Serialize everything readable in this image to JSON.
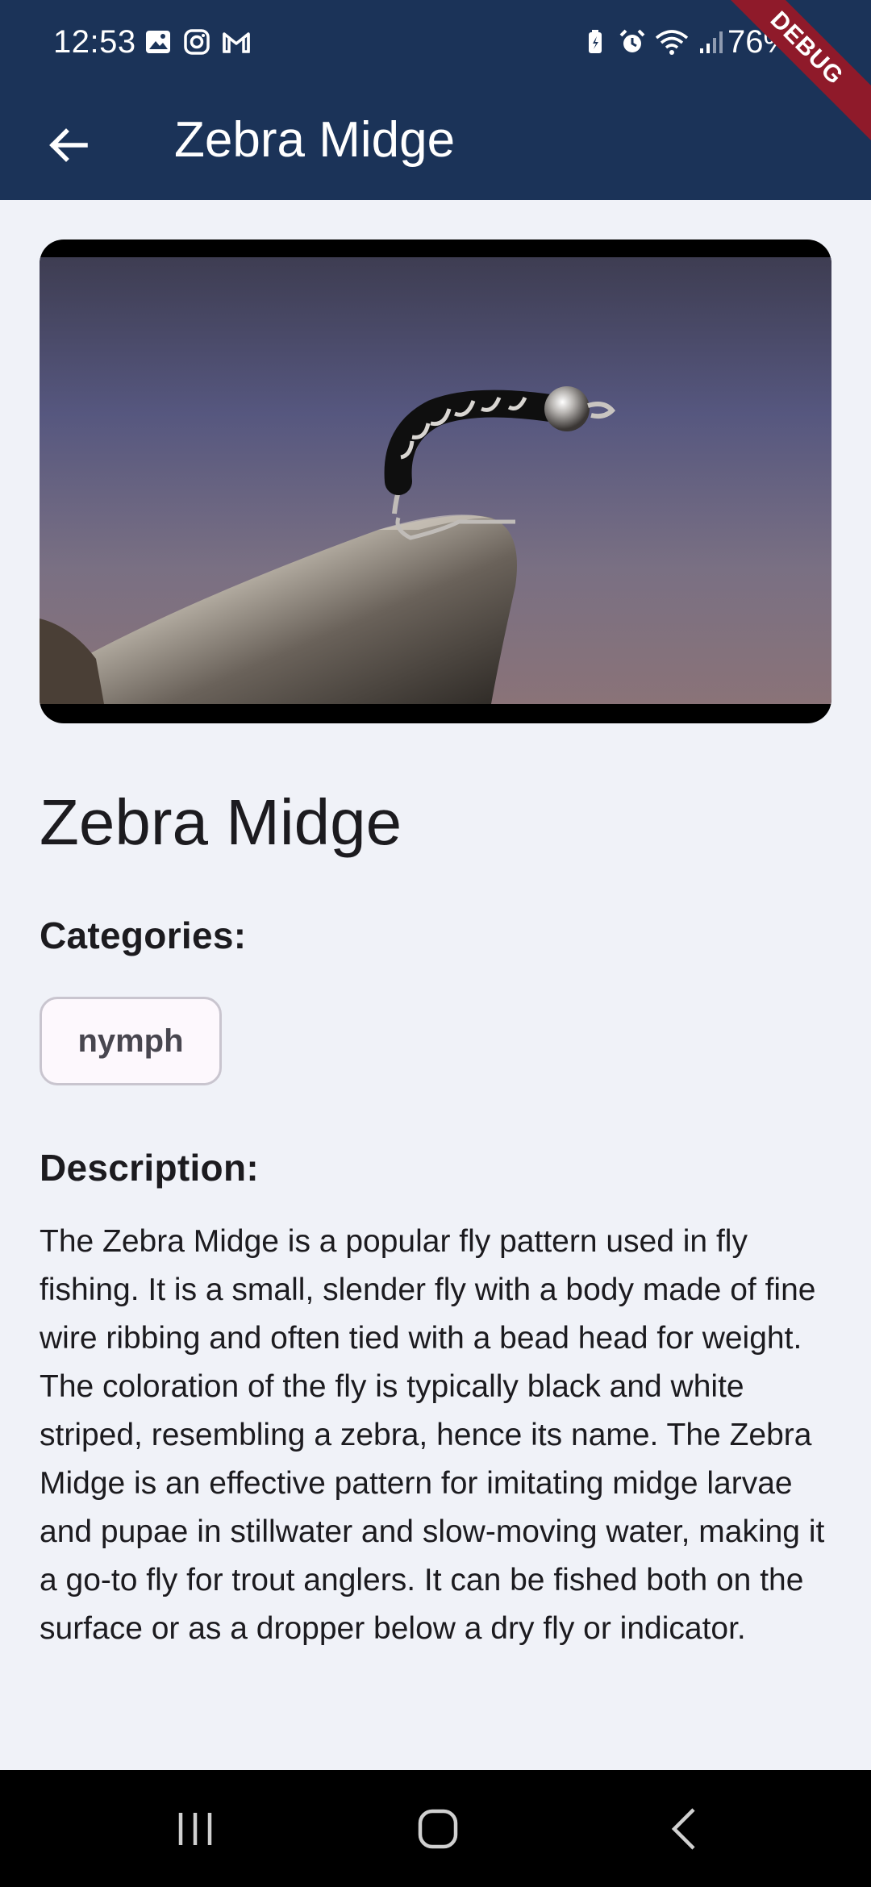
{
  "status_bar": {
    "time": "12:53",
    "battery": "76%",
    "left_icons": [
      "gallery-icon",
      "instagram-icon",
      "gmail-icon"
    ],
    "right_icons": [
      "battery-saver-icon",
      "alarm-icon",
      "wifi-icon",
      "signal-icon"
    ]
  },
  "app_bar": {
    "title": "Zebra Midge",
    "back_icon": "arrow-back-icon",
    "background": "#1b3358"
  },
  "debug_banner": "DEBUG",
  "hero_image": {
    "subject": "fly-tying-vise-image"
  },
  "detail": {
    "heading": "Zebra Midge",
    "categories_label": "Categories:",
    "categories": [
      "nymph"
    ],
    "description_label": "Description:",
    "description": "The Zebra Midge is a popular fly pattern used in fly fishing. It is a small, slender fly with a body made of fine wire ribbing and often tied with a bead head for weight. The coloration of the fly is typically black and white striped, resembling a zebra, hence its name. The Zebra Midge is an effective pattern for imitating midge larvae and pupae in stillwater and slow-moving water, making it a go-to fly for trout anglers. It can be fished both on the surface or as a dropper below a dry fly or indicator."
  },
  "nav_bar": {
    "buttons": [
      "recents-icon",
      "home-icon",
      "back-icon"
    ]
  }
}
